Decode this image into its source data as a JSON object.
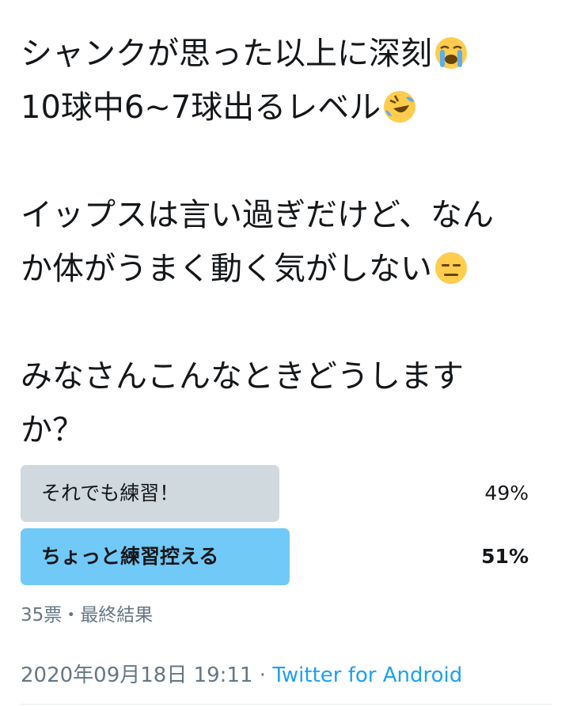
{
  "tweet": {
    "line1": "シャンクが思った以上に深刻",
    "line2": "10球中6~7球出るレベル",
    "line3": "イップスは言い過ぎだけど、なん",
    "line4": "か体がうまく動く気がしない",
    "line5": "みなさんこんなときどうします",
    "line6": "か？",
    "emoji1": "loudly-crying-face-emoji",
    "emoji2": "rolling-on-floor-laughing-emoji",
    "emoji3": "expressionless-face-emoji"
  },
  "poll": {
    "options": [
      {
        "label": "それでも練習！",
        "percent": "49%",
        "fraction": 0.49,
        "winner": false
      },
      {
        "label": "ちょっと練習控える",
        "percent": "51%",
        "fraction": 0.51,
        "winner": true
      }
    ],
    "meta": "35票・最終結果"
  },
  "footer": {
    "timestamp": "2020年09月18日 19:11 · ",
    "source": "Twitter for Android"
  },
  "colors": {
    "text": "#14171a",
    "muted": "#657786",
    "link": "#1da1f2",
    "bar_loser": "#cfd9de",
    "bar_winner": "#71c9f8"
  }
}
